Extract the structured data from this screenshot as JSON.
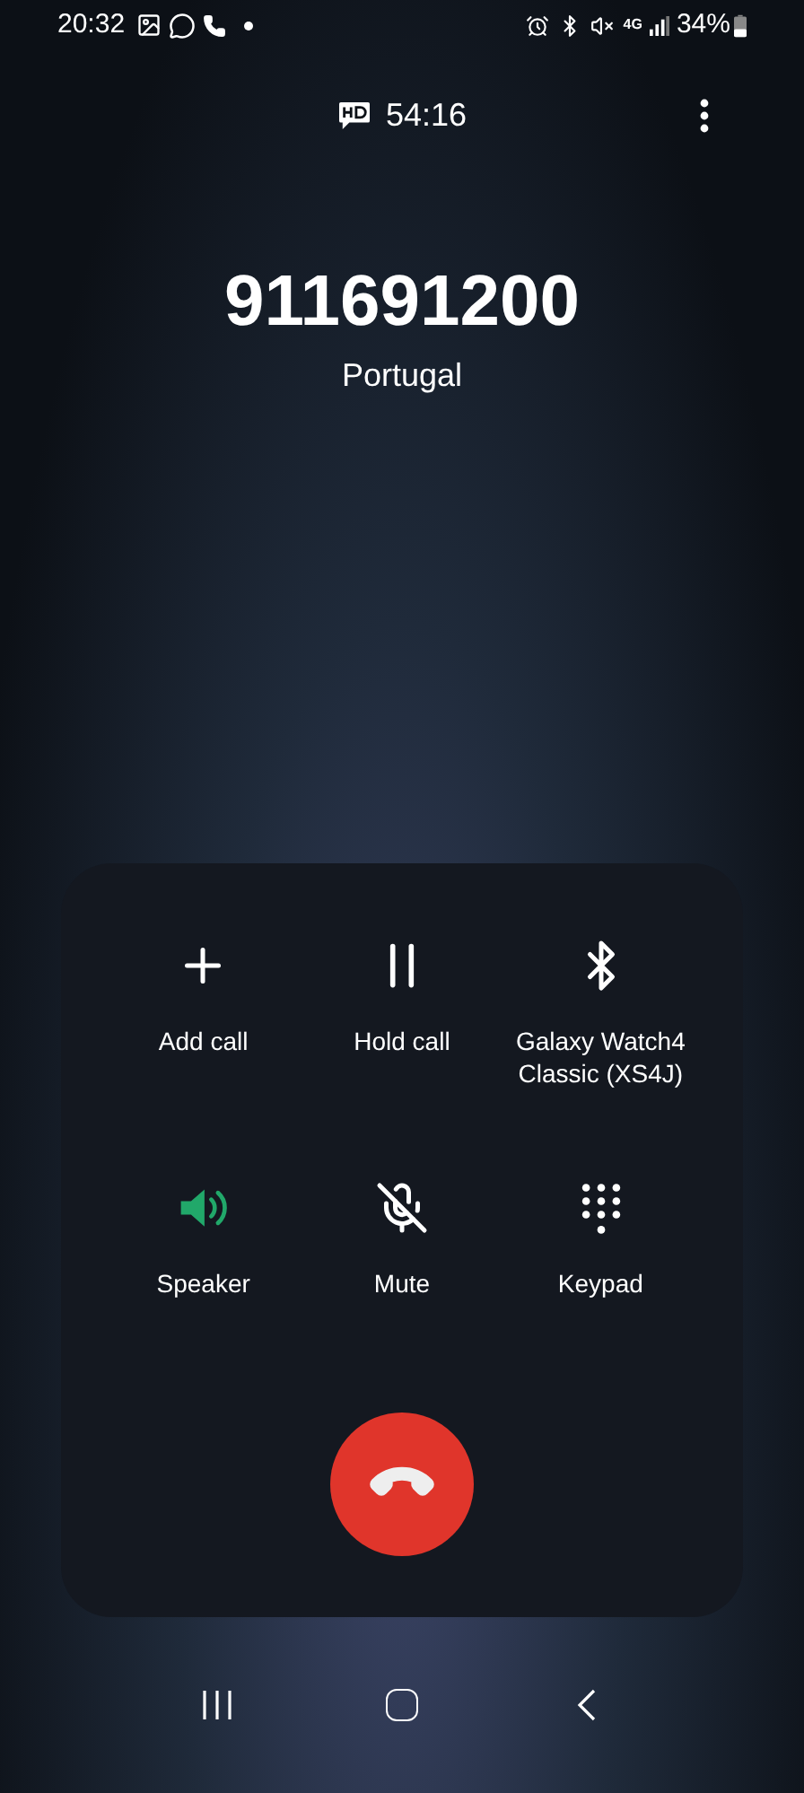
{
  "status_bar": {
    "time": "20:32",
    "network": "4G",
    "battery": "34%"
  },
  "call": {
    "duration": "54:16",
    "number": "911691200",
    "location": "Portugal"
  },
  "controls": [
    {
      "kind": "add",
      "label": "Add call",
      "on": false
    },
    {
      "kind": "hold",
      "label": "Hold call",
      "on": false
    },
    {
      "kind": "bluetooth",
      "label": "Galaxy Watch4 Classic (XS4J)",
      "on": false
    },
    {
      "kind": "speaker",
      "label": "Speaker",
      "on": true
    },
    {
      "kind": "mute",
      "label": "Mute",
      "on": false
    },
    {
      "kind": "keypad",
      "label": "Keypad",
      "on": false
    }
  ]
}
